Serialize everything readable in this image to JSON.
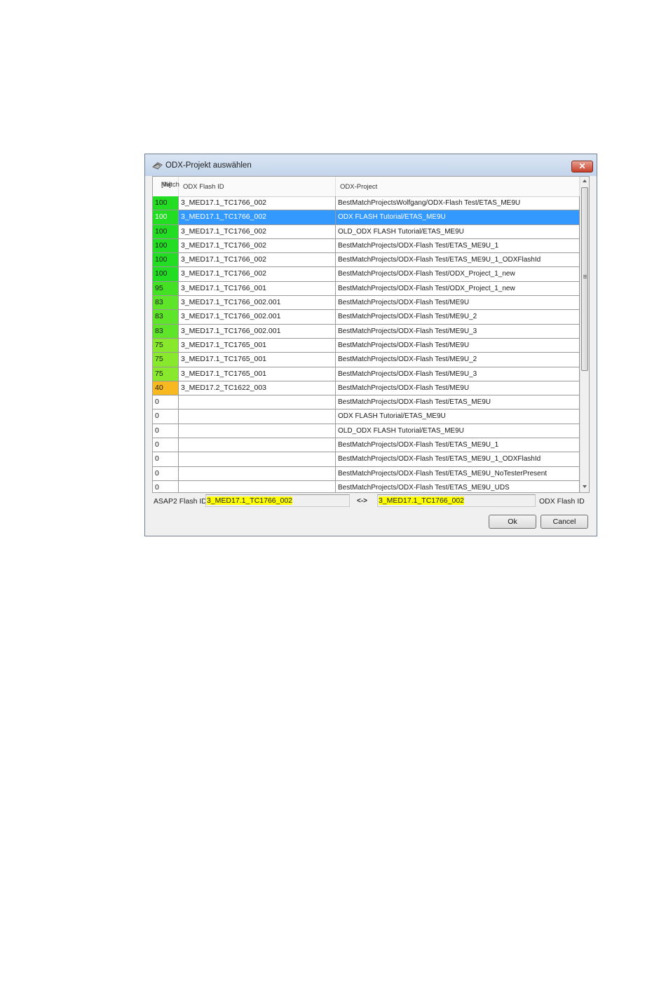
{
  "dialog": {
    "title": "ODX-Projekt auswählen",
    "close_label": "✕",
    "ok_label": "Ok",
    "cancel_label": "Cancel"
  },
  "table": {
    "headers": {
      "match_line1": "Match",
      "match_line2": "[%]",
      "odx_flash_id": "ODX Flash ID",
      "odx_project": "ODX-Project"
    },
    "selected_row": 1,
    "rows": [
      {
        "match": "100",
        "odx_flash_id": "3_MED17.1_TC1766_002",
        "odx_project": "BestMatchProjectsWolfgang/ODX-Flash Test/ETAS_ME9U",
        "color": "#22dd22"
      },
      {
        "match": "100",
        "odx_flash_id": "3_MED17.1_TC1766_002",
        "odx_project": "ODX FLASH Tutorial/ETAS_ME9U",
        "color": "#22dd22"
      },
      {
        "match": "100",
        "odx_flash_id": "3_MED17.1_TC1766_002",
        "odx_project": "OLD_ODX FLASH Tutorial/ETAS_ME9U",
        "color": "#22dd22"
      },
      {
        "match": "100",
        "odx_flash_id": "3_MED17.1_TC1766_002",
        "odx_project": "BestMatchProjects/ODX-Flash Test/ETAS_ME9U_1",
        "color": "#22dd22"
      },
      {
        "match": "100",
        "odx_flash_id": "3_MED17.1_TC1766_002",
        "odx_project": "BestMatchProjects/ODX-Flash Test/ETAS_ME9U_1_ODXFlashId",
        "color": "#22dd22"
      },
      {
        "match": "100",
        "odx_flash_id": "3_MED17.1_TC1766_002",
        "odx_project": "BestMatchProjects/ODX-Flash Test/ODX_Project_1_new",
        "color": "#22dd22"
      },
      {
        "match": "95",
        "odx_flash_id": "3_MED17.1_TC1766_001",
        "odx_project": "BestMatchProjects/ODX-Flash Test/ODX_Project_1_new",
        "color": "#44e024"
      },
      {
        "match": "83",
        "odx_flash_id": "3_MED17.1_TC1766_002.001",
        "odx_project": "BestMatchProjects/ODX-Flash Test/ME9U",
        "color": "#5ee428"
      },
      {
        "match": "83",
        "odx_flash_id": "3_MED17.1_TC1766_002.001",
        "odx_project": "BestMatchProjects/ODX-Flash Test/ME9U_2",
        "color": "#5ee428"
      },
      {
        "match": "83",
        "odx_flash_id": "3_MED17.1_TC1766_002.001",
        "odx_project": "BestMatchProjects/ODX-Flash Test/ME9U_3",
        "color": "#5ee428"
      },
      {
        "match": "75",
        "odx_flash_id": "3_MED17.1_TC1765_001",
        "odx_project": "BestMatchProjects/ODX-Flash Test/ME9U",
        "color": "#88e82c"
      },
      {
        "match": "75",
        "odx_flash_id": "3_MED17.1_TC1765_001",
        "odx_project": "BestMatchProjects/ODX-Flash Test/ME9U_2",
        "color": "#88e82c"
      },
      {
        "match": "75",
        "odx_flash_id": "3_MED17.1_TC1765_001",
        "odx_project": "BestMatchProjects/ODX-Flash Test/ME9U_3",
        "color": "#88e82c"
      },
      {
        "match": "40",
        "odx_flash_id": "3_MED17.2_TC1622_003",
        "odx_project": "BestMatchProjects/ODX-Flash Test/ME9U",
        "color": "#f8b820"
      },
      {
        "match": "0",
        "odx_flash_id": "",
        "odx_project": "BestMatchProjects/ODX-Flash Test/ETAS_ME9U",
        "color": "#ffffff"
      },
      {
        "match": "0",
        "odx_flash_id": "",
        "odx_project": "ODX FLASH Tutorial/ETAS_ME9U",
        "color": "#ffffff"
      },
      {
        "match": "0",
        "odx_flash_id": "",
        "odx_project": "OLD_ODX FLASH Tutorial/ETAS_ME9U",
        "color": "#ffffff"
      },
      {
        "match": "0",
        "odx_flash_id": "",
        "odx_project": "BestMatchProjects/ODX-Flash Test/ETAS_ME9U_1",
        "color": "#ffffff"
      },
      {
        "match": "0",
        "odx_flash_id": "",
        "odx_project": "BestMatchProjects/ODX-Flash Test/ETAS_ME9U_1_ODXFlashId",
        "color": "#ffffff"
      },
      {
        "match": "0",
        "odx_flash_id": "",
        "odx_project": "BestMatchProjects/ODX-Flash Test/ETAS_ME9U_NoTesterPresent",
        "color": "#ffffff"
      },
      {
        "match": "0",
        "odx_flash_id": "",
        "odx_project": "BestMatchProjects/ODX-Flash Test/ETAS_ME9U_UDS",
        "color": "#ffffff"
      }
    ]
  },
  "footer": {
    "asap2_label": "ASAP2 Flash ID",
    "asap2_value": "3_MED17.1_TC1766_002",
    "arrow_label": "<->",
    "odx_value": "3_MED17.1_TC1766_002",
    "odx_label": "ODX Flash ID"
  }
}
